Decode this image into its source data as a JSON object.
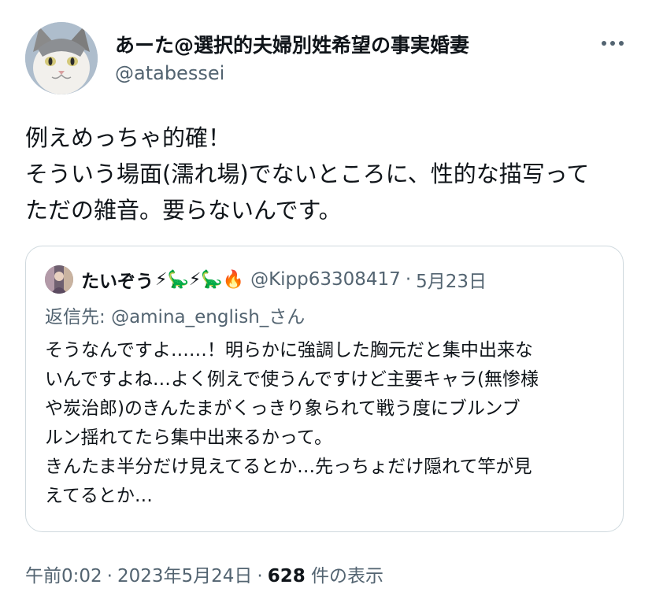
{
  "author": {
    "display_name": "あーた@選択的夫婦別姓希望の事実婚妻",
    "handle": "@atabessei",
    "avatar_icon": "cat-avatar-icon"
  },
  "more_icon": "more-dots-icon",
  "tweet": {
    "lines": [
      "例えめっちゃ的確！",
      "そういう場面(濡れ場)でないところに、性的な描写って",
      "ただの雑音。要らないんです。"
    ]
  },
  "quote": {
    "name": "たいぞう",
    "emojis": "⚡🦕⚡🦕🔥",
    "handle": "@Kipp63308417",
    "separator": "·",
    "date": "5月23日",
    "reply_prefix": "返信先: ",
    "reply_mention": "@amina_english_",
    "reply_suffix": "さん",
    "lines": [
      "そうなんですよ……！明らかに強調した胸元だと集中出来な",
      "いんですよね…よく例えで使うんですけど主要キャラ(無惨様",
      "や炭治郎)のきんたまがくっきり象られて戦う度にブルンブ",
      "ルン揺れてたら集中出来るかって。",
      "きんたま半分だけ見えてるとか…先っちょだけ隠れて竿が見",
      "えてるとか…"
    ]
  },
  "meta": {
    "time": "午前0:02",
    "separator": "·",
    "date": "2023年5月24日",
    "views_count": "628",
    "views_label": " 件の表示"
  },
  "colors": {
    "text_primary": "#0f1419",
    "text_secondary": "#536471",
    "border": "#cfd9de"
  }
}
